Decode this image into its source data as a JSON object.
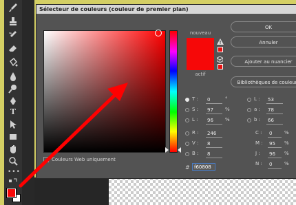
{
  "dialog": {
    "title": "Sélecteur de couleurs (couleur de premier plan)",
    "new_label": "nouveau",
    "current_label": "actif",
    "web_only_label": "Couleurs Web uniquement",
    "hex_prefix": "#",
    "hex_value": "f60808"
  },
  "buttons": {
    "ok": "OK",
    "cancel": "Annuler",
    "add_swatch": "Ajouter au nuancier",
    "libraries": "Bibliothèques de couleurs"
  },
  "hsb": {
    "h_label": "T :",
    "h_value": "0",
    "h_unit": "°",
    "s_label": "S :",
    "s_value": "97",
    "s_unit": "%",
    "b_label": "L :",
    "b_value": "96",
    "b_unit": "%"
  },
  "rgb": {
    "r_label": "R :",
    "r_value": "246",
    "g_label": "V :",
    "g_value": "8",
    "b_label": "B :",
    "b_value": "8"
  },
  "lab": {
    "l_label": "L :",
    "l_value": "53",
    "a_label": "a :",
    "a_value": "78",
    "b_label": "b :",
    "b_value": "66"
  },
  "cmyk": {
    "c_label": "C :",
    "c_value": "0",
    "c_unit": "%",
    "m_label": "M :",
    "m_value": "95",
    "m_unit": "%",
    "j_label": "J :",
    "j_value": "96",
    "j_unit": "%",
    "n_label": "N :",
    "n_value": "0",
    "n_unit": "%"
  },
  "colors": {
    "selected": "#f60808",
    "warning_swatch": "#e81010",
    "annotation_arrow": "#ff0000",
    "foreground": "#f60808",
    "background": "#ffffff"
  },
  "toolbar": {
    "icons": [
      "brush-icon",
      "stamp-icon",
      "history-brush-icon",
      "eraser-icon",
      "paint-bucket-icon",
      "blur-icon",
      "dodge-icon",
      "pen-icon",
      "type-icon",
      "path-selection-icon",
      "rectangle-icon",
      "hand-icon",
      "zoom-icon",
      "more-tools-icon",
      "swap-colors-icon"
    ]
  }
}
